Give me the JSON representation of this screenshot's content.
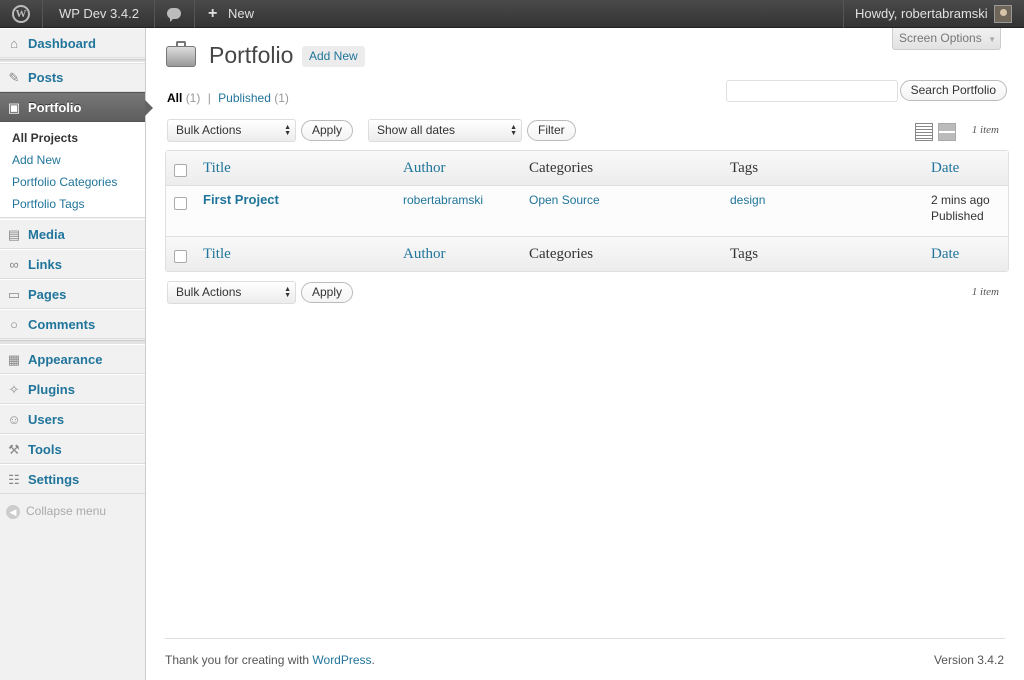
{
  "admin_bar": {
    "site_name": "WP Dev 3.4.2",
    "new_label": "New",
    "plus": "+",
    "howdy": "Howdy, robertabramski",
    "wp_logo_glyph": "W"
  },
  "sidebar": {
    "items": [
      {
        "label": "Dashboard",
        "icon": "dashboard-icon",
        "glyph": "⌂"
      },
      {
        "label": "Posts",
        "icon": "pin-icon",
        "glyph": "✎"
      },
      {
        "label": "Portfolio",
        "icon": "briefcase-icon",
        "glyph": "▣"
      },
      {
        "label": "Media",
        "icon": "media-icon",
        "glyph": "▤"
      },
      {
        "label": "Links",
        "icon": "link-icon",
        "glyph": "∞"
      },
      {
        "label": "Pages",
        "icon": "pages-icon",
        "glyph": "▭"
      },
      {
        "label": "Comments",
        "icon": "comment-icon",
        "glyph": "○"
      },
      {
        "label": "Appearance",
        "icon": "appearance-icon",
        "glyph": "▦"
      },
      {
        "label": "Plugins",
        "icon": "plug-icon",
        "glyph": "✧"
      },
      {
        "label": "Users",
        "icon": "users-icon",
        "glyph": "☺"
      },
      {
        "label": "Tools",
        "icon": "tools-icon",
        "glyph": "⚒"
      },
      {
        "label": "Settings",
        "icon": "settings-icon",
        "glyph": "☷"
      }
    ],
    "submenu": [
      "All Projects",
      "Add New",
      "Portfolio Categories",
      "Portfolio Tags"
    ],
    "collapse": "Collapse menu",
    "collapse_glyph": "◀"
  },
  "header": {
    "screen_options": "Screen Options",
    "screen_options_arrow": "▼",
    "title": "Portfolio",
    "add_new": "Add New"
  },
  "filters": {
    "all": "All",
    "all_count": "(1)",
    "divider": "|",
    "published": "Published",
    "published_count": "(1)"
  },
  "search": {
    "button": "Search Portfolio",
    "value": ""
  },
  "toolbar": {
    "bulk_actions": "Bulk Actions",
    "apply": "Apply",
    "dates": "Show all dates",
    "filter": "Filter",
    "count": "1 item",
    "arrows": "▲\n▼"
  },
  "table": {
    "columns": [
      "Title",
      "Author",
      "Categories",
      "Tags",
      "Date"
    ],
    "rows": [
      {
        "title": "First Project",
        "author": "robertabramski",
        "categories": "Open Source",
        "tags": "design",
        "date": "2 mins ago",
        "status": "Published"
      }
    ]
  },
  "footer": {
    "thanks": "Thank you for creating with ",
    "wordpress": "WordPress",
    "period": ".",
    "version": "Version 3.4.2"
  }
}
